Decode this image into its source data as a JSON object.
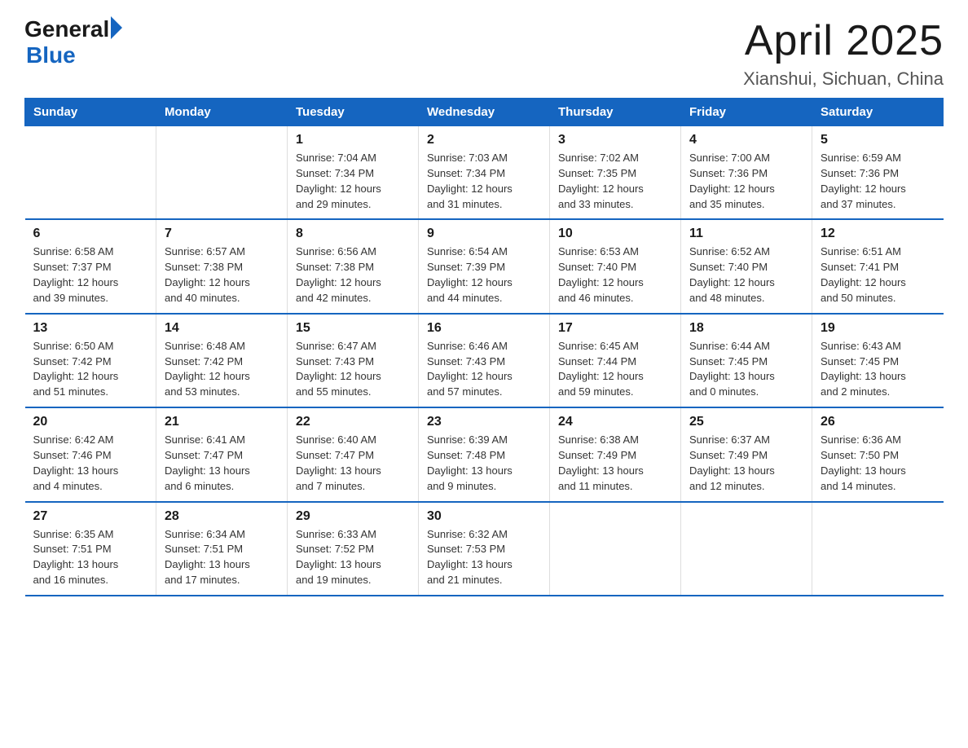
{
  "logo": {
    "general": "General",
    "blue": "Blue"
  },
  "title": "April 2025",
  "subtitle": "Xianshui, Sichuan, China",
  "headers": [
    "Sunday",
    "Monday",
    "Tuesday",
    "Wednesday",
    "Thursday",
    "Friday",
    "Saturday"
  ],
  "weeks": [
    [
      {
        "day": "",
        "info": ""
      },
      {
        "day": "",
        "info": ""
      },
      {
        "day": "1",
        "info": "Sunrise: 7:04 AM\nSunset: 7:34 PM\nDaylight: 12 hours\nand 29 minutes."
      },
      {
        "day": "2",
        "info": "Sunrise: 7:03 AM\nSunset: 7:34 PM\nDaylight: 12 hours\nand 31 minutes."
      },
      {
        "day": "3",
        "info": "Sunrise: 7:02 AM\nSunset: 7:35 PM\nDaylight: 12 hours\nand 33 minutes."
      },
      {
        "day": "4",
        "info": "Sunrise: 7:00 AM\nSunset: 7:36 PM\nDaylight: 12 hours\nand 35 minutes."
      },
      {
        "day": "5",
        "info": "Sunrise: 6:59 AM\nSunset: 7:36 PM\nDaylight: 12 hours\nand 37 minutes."
      }
    ],
    [
      {
        "day": "6",
        "info": "Sunrise: 6:58 AM\nSunset: 7:37 PM\nDaylight: 12 hours\nand 39 minutes."
      },
      {
        "day": "7",
        "info": "Sunrise: 6:57 AM\nSunset: 7:38 PM\nDaylight: 12 hours\nand 40 minutes."
      },
      {
        "day": "8",
        "info": "Sunrise: 6:56 AM\nSunset: 7:38 PM\nDaylight: 12 hours\nand 42 minutes."
      },
      {
        "day": "9",
        "info": "Sunrise: 6:54 AM\nSunset: 7:39 PM\nDaylight: 12 hours\nand 44 minutes."
      },
      {
        "day": "10",
        "info": "Sunrise: 6:53 AM\nSunset: 7:40 PM\nDaylight: 12 hours\nand 46 minutes."
      },
      {
        "day": "11",
        "info": "Sunrise: 6:52 AM\nSunset: 7:40 PM\nDaylight: 12 hours\nand 48 minutes."
      },
      {
        "day": "12",
        "info": "Sunrise: 6:51 AM\nSunset: 7:41 PM\nDaylight: 12 hours\nand 50 minutes."
      }
    ],
    [
      {
        "day": "13",
        "info": "Sunrise: 6:50 AM\nSunset: 7:42 PM\nDaylight: 12 hours\nand 51 minutes."
      },
      {
        "day": "14",
        "info": "Sunrise: 6:48 AM\nSunset: 7:42 PM\nDaylight: 12 hours\nand 53 minutes."
      },
      {
        "day": "15",
        "info": "Sunrise: 6:47 AM\nSunset: 7:43 PM\nDaylight: 12 hours\nand 55 minutes."
      },
      {
        "day": "16",
        "info": "Sunrise: 6:46 AM\nSunset: 7:43 PM\nDaylight: 12 hours\nand 57 minutes."
      },
      {
        "day": "17",
        "info": "Sunrise: 6:45 AM\nSunset: 7:44 PM\nDaylight: 12 hours\nand 59 minutes."
      },
      {
        "day": "18",
        "info": "Sunrise: 6:44 AM\nSunset: 7:45 PM\nDaylight: 13 hours\nand 0 minutes."
      },
      {
        "day": "19",
        "info": "Sunrise: 6:43 AM\nSunset: 7:45 PM\nDaylight: 13 hours\nand 2 minutes."
      }
    ],
    [
      {
        "day": "20",
        "info": "Sunrise: 6:42 AM\nSunset: 7:46 PM\nDaylight: 13 hours\nand 4 minutes."
      },
      {
        "day": "21",
        "info": "Sunrise: 6:41 AM\nSunset: 7:47 PM\nDaylight: 13 hours\nand 6 minutes."
      },
      {
        "day": "22",
        "info": "Sunrise: 6:40 AM\nSunset: 7:47 PM\nDaylight: 13 hours\nand 7 minutes."
      },
      {
        "day": "23",
        "info": "Sunrise: 6:39 AM\nSunset: 7:48 PM\nDaylight: 13 hours\nand 9 minutes."
      },
      {
        "day": "24",
        "info": "Sunrise: 6:38 AM\nSunset: 7:49 PM\nDaylight: 13 hours\nand 11 minutes."
      },
      {
        "day": "25",
        "info": "Sunrise: 6:37 AM\nSunset: 7:49 PM\nDaylight: 13 hours\nand 12 minutes."
      },
      {
        "day": "26",
        "info": "Sunrise: 6:36 AM\nSunset: 7:50 PM\nDaylight: 13 hours\nand 14 minutes."
      }
    ],
    [
      {
        "day": "27",
        "info": "Sunrise: 6:35 AM\nSunset: 7:51 PM\nDaylight: 13 hours\nand 16 minutes."
      },
      {
        "day": "28",
        "info": "Sunrise: 6:34 AM\nSunset: 7:51 PM\nDaylight: 13 hours\nand 17 minutes."
      },
      {
        "day": "29",
        "info": "Sunrise: 6:33 AM\nSunset: 7:52 PM\nDaylight: 13 hours\nand 19 minutes."
      },
      {
        "day": "30",
        "info": "Sunrise: 6:32 AM\nSunset: 7:53 PM\nDaylight: 13 hours\nand 21 minutes."
      },
      {
        "day": "",
        "info": ""
      },
      {
        "day": "",
        "info": ""
      },
      {
        "day": "",
        "info": ""
      }
    ]
  ]
}
